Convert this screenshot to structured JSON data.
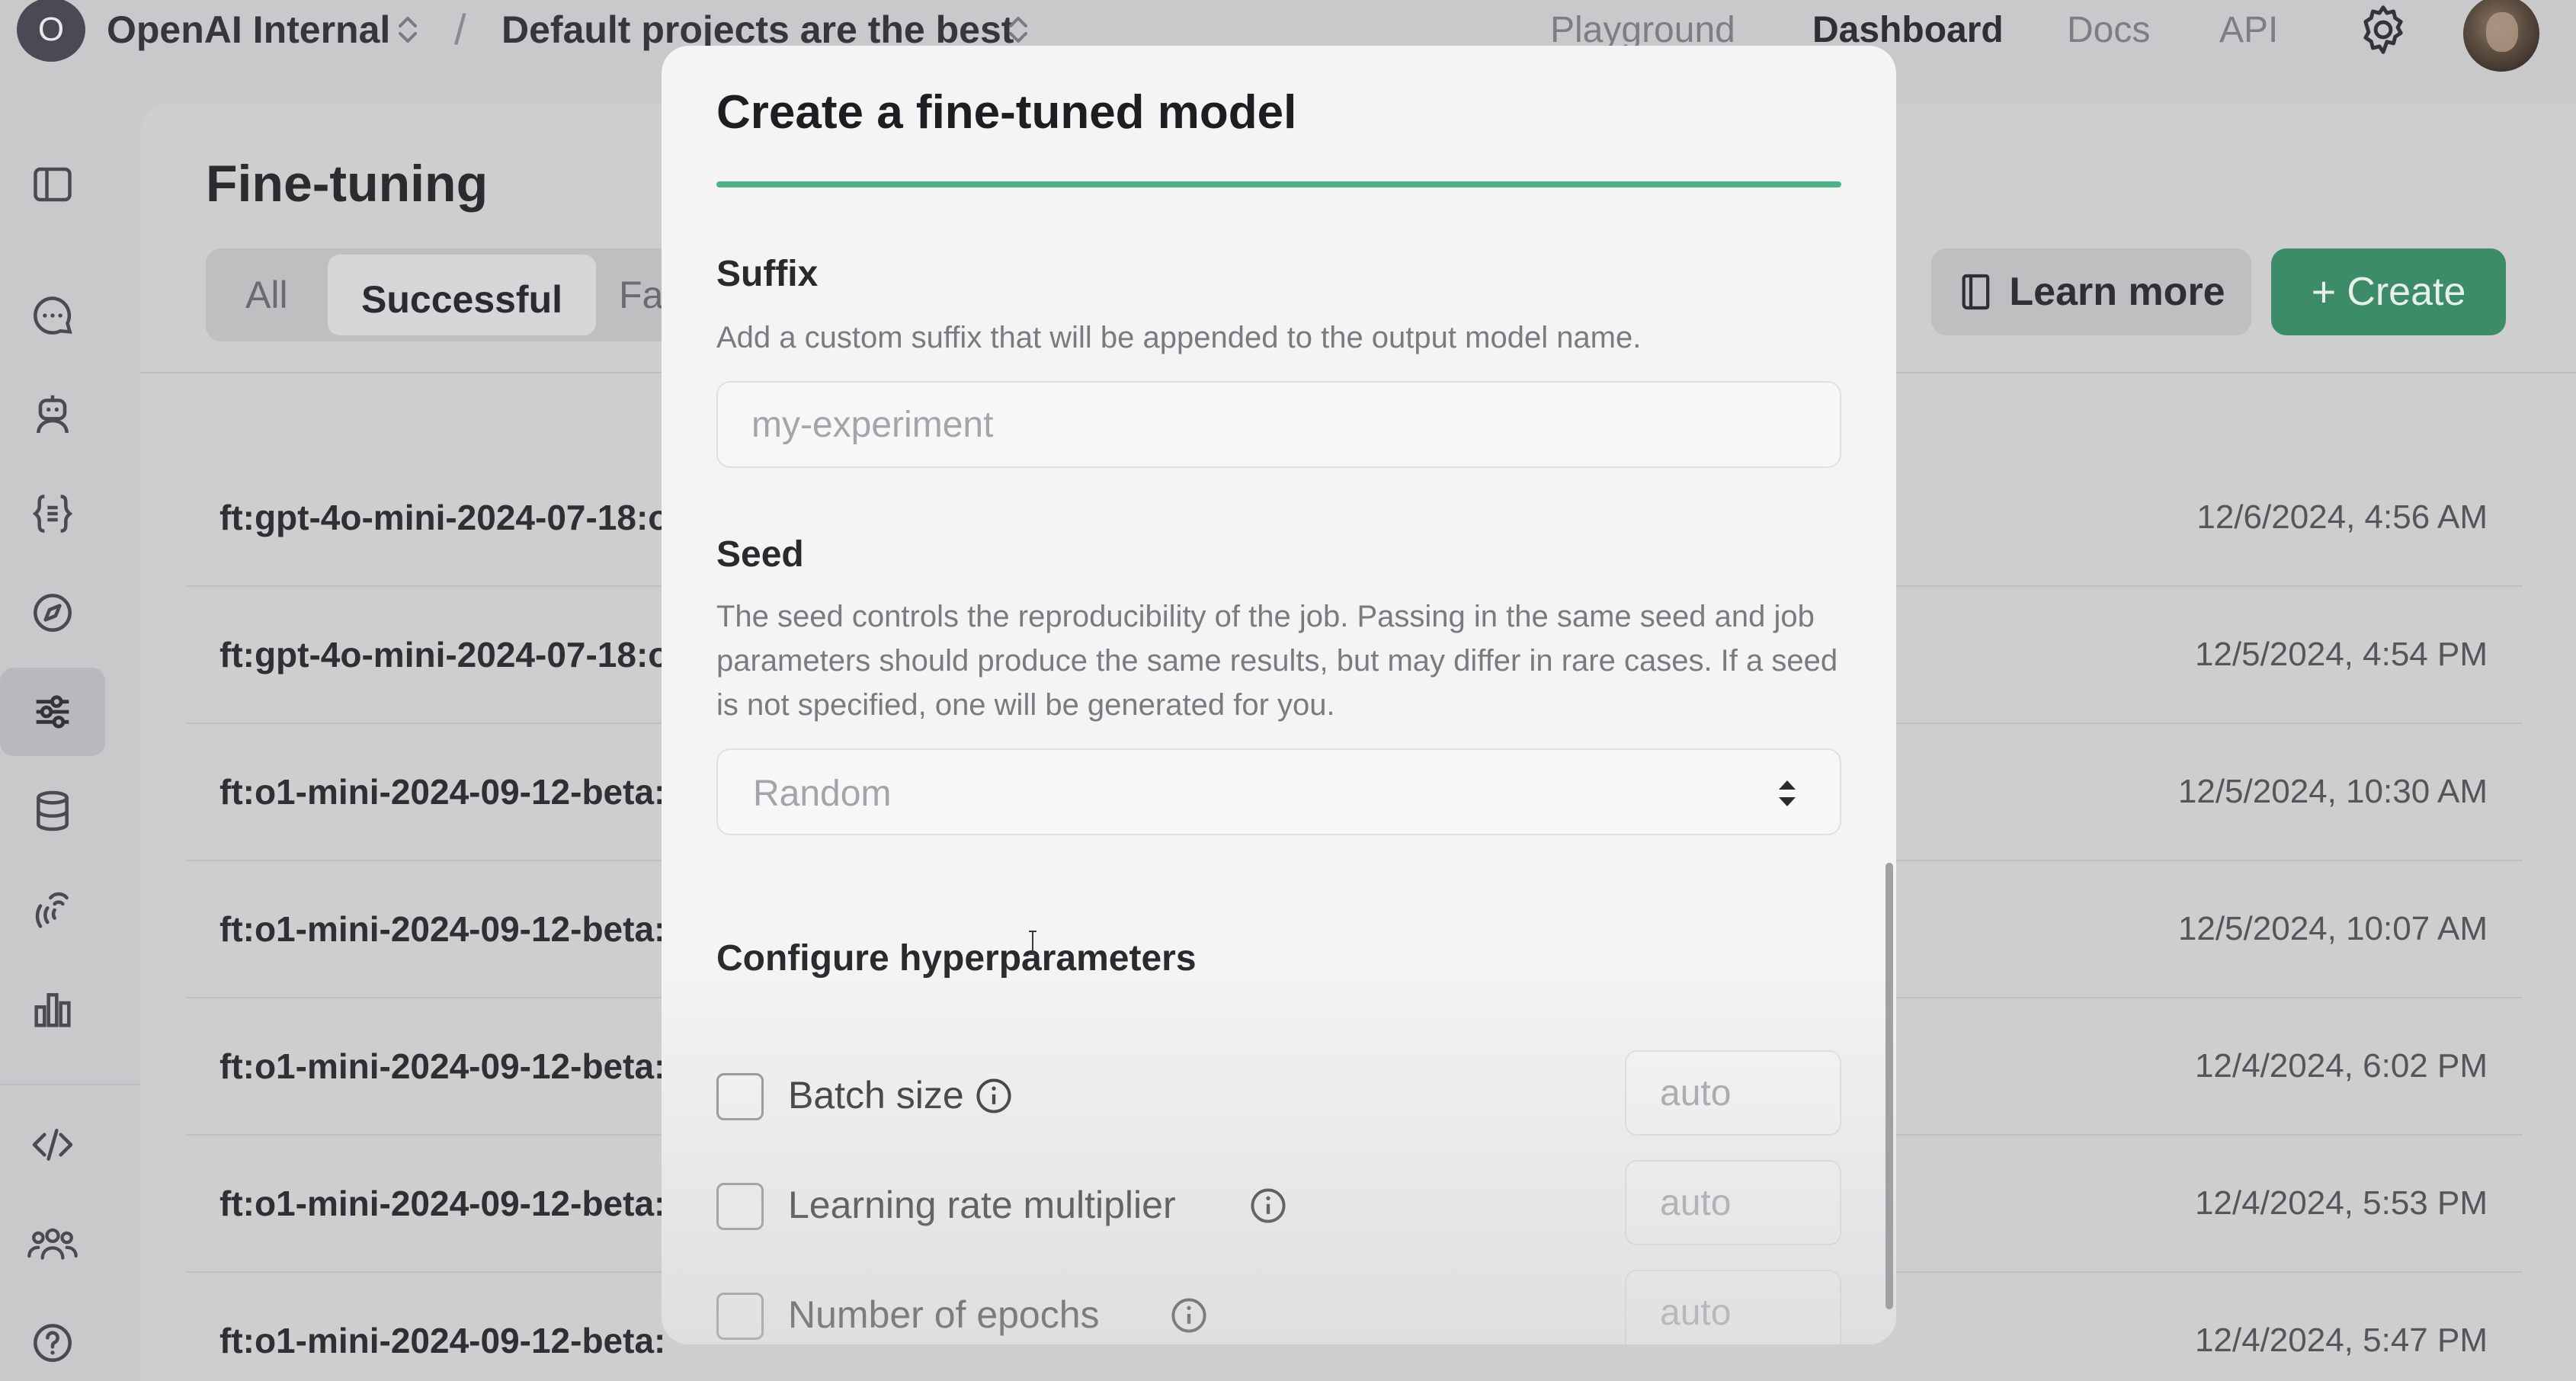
{
  "topbar": {
    "org_initial": "O",
    "org_name": "OpenAI Internal",
    "separator": "/",
    "project_name": "Default projects are the best",
    "nav": [
      {
        "label": "Playground",
        "active": false
      },
      {
        "label": "Dashboard",
        "active": true
      },
      {
        "label": "Docs",
        "active": false
      },
      {
        "label": "API",
        "active": false
      }
    ],
    "settings_icon": "gear-icon",
    "avatar_icon": "user-avatar"
  },
  "rail": {
    "items": [
      {
        "icon": "sidebar-toggle-icon",
        "active": false
      },
      {
        "icon": "chat-icon",
        "active": false
      },
      {
        "icon": "assistant-robot-icon",
        "active": false
      },
      {
        "icon": "json-braces-icon",
        "active": false
      },
      {
        "icon": "compass-icon",
        "active": false
      },
      {
        "icon": "sliders-icon",
        "active": true
      },
      {
        "icon": "database-icon",
        "active": false
      },
      {
        "icon": "audio-wave-icon",
        "active": false
      },
      {
        "icon": "bar-chart-icon",
        "active": false
      },
      {
        "icon": "code-icon",
        "active": false
      },
      {
        "icon": "users-icon",
        "active": false
      },
      {
        "icon": "help-icon",
        "active": false
      }
    ]
  },
  "main": {
    "title": "Fine-tuning",
    "tabs": [
      {
        "label": "All",
        "active": false
      },
      {
        "label": "Successful",
        "active": true
      },
      {
        "label": "Fa",
        "active": false
      }
    ],
    "learn_more_label": "Learn more",
    "create_label": "Create",
    "jobs": [
      {
        "name": "ft:gpt-4o-mini-2024-07-18:o",
        "date": "12/6/2024, 4:56 AM"
      },
      {
        "name": "ft:gpt-4o-mini-2024-07-18:o",
        "date": "12/5/2024, 4:54 PM"
      },
      {
        "name": "ft:o1-mini-2024-09-12-beta:",
        "date": "12/5/2024, 10:30 AM"
      },
      {
        "name": "ft:o1-mini-2024-09-12-beta:",
        "date": "12/5/2024, 10:07 AM"
      },
      {
        "name": "ft:o1-mini-2024-09-12-beta:",
        "date": "12/4/2024, 6:02 PM"
      },
      {
        "name": "ft:o1-mini-2024-09-12-beta:",
        "date": "12/4/2024, 5:53 PM"
      },
      {
        "name": "ft:o1-mini-2024-09-12-beta:",
        "date": "12/4/2024, 5:47 PM"
      }
    ]
  },
  "modal": {
    "title": "Create a fine-tuned model",
    "suffix": {
      "label": "Suffix",
      "description": "Add a custom suffix that will be appended to the output model name.",
      "placeholder": "my-experiment",
      "value": ""
    },
    "seed": {
      "label": "Seed",
      "description": "The seed controls the reproducibility of the job. Passing in the same seed and job parameters should produce the same results, but may differ in rare cases. If a seed is not specified, one will be generated for you.",
      "selected": "Random"
    },
    "hyperparameters": {
      "title": "Configure hyperparameters",
      "items": [
        {
          "label": "Batch size",
          "placeholder": "auto",
          "checked": false
        },
        {
          "label": "Learning rate multiplier",
          "placeholder": "auto",
          "checked": false
        },
        {
          "label": "Number of epochs",
          "placeholder": "auto",
          "checked": false
        }
      ]
    }
  },
  "colors": {
    "accent_green": "#4bb486",
    "create_button": "#3c8c6a",
    "backdrop": "#c9c9cc",
    "modal_bg": "#f4f4f5"
  }
}
